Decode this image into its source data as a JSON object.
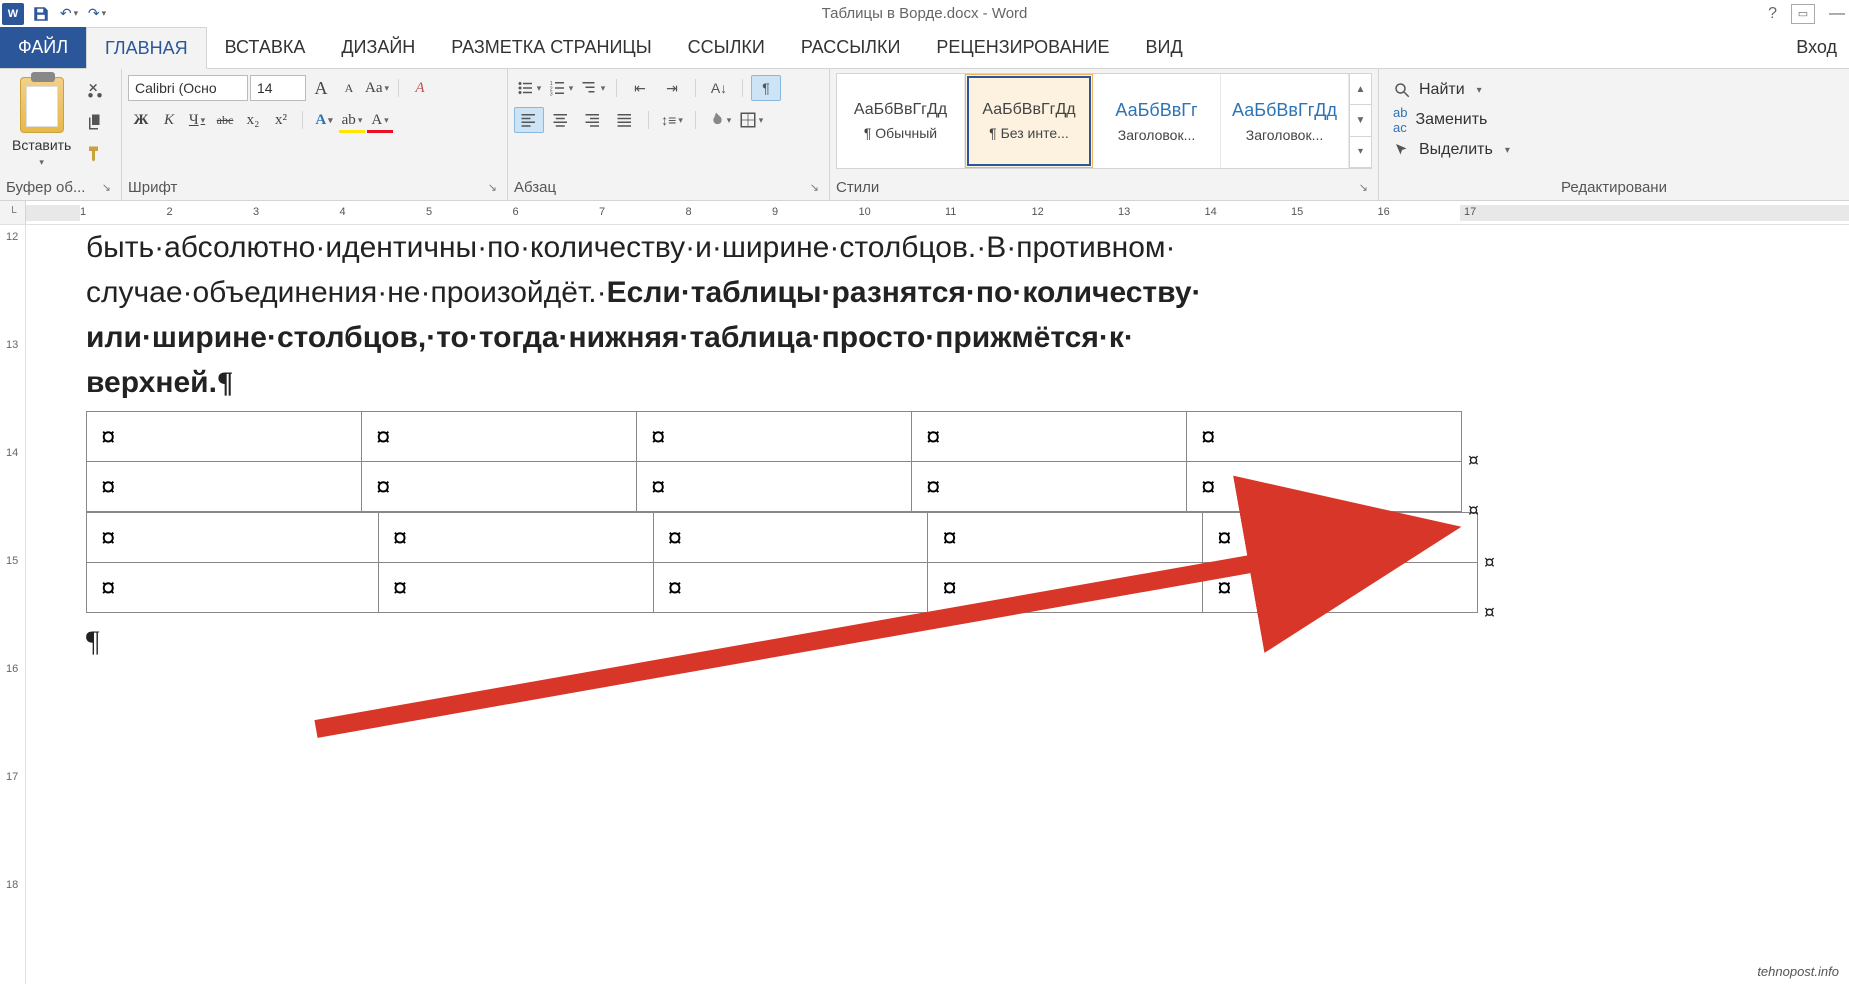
{
  "title": {
    "filename": "Таблицы в Ворде.docx",
    "appname": "Word"
  },
  "qat": {
    "undo": "↶",
    "redo": "↷"
  },
  "window_controls": {
    "help": "?",
    "ribbon_opts": "▭",
    "minimize": "—"
  },
  "tabs": {
    "file": "ФАЙЛ",
    "home": "ГЛАВНАЯ",
    "insert": "ВСТАВКА",
    "design": "ДИЗАЙН",
    "layout": "РАЗМЕТКА СТРАНИЦЫ",
    "references": "ССЫЛКИ",
    "mailings": "РАССЫЛКИ",
    "review": "РЕЦЕНЗИРОВАНИЕ",
    "view": "ВИД",
    "signin": "Вход"
  },
  "clipboard": {
    "paste": "Вставить",
    "group": "Буфер об..."
  },
  "font": {
    "name": "Calibri (Осно",
    "size": "14",
    "group": "Шрифт",
    "bold": "Ж",
    "italic": "К",
    "underline": "Ч",
    "strike": "abc",
    "sub": "x₂",
    "sup": "x²",
    "grow": "A",
    "shrink": "A",
    "case": "Aa",
    "clear": "A"
  },
  "paragraph": {
    "group": "Абзац"
  },
  "styles": {
    "group": "Стили",
    "items": [
      {
        "preview": "АаБбВвГгДд",
        "name": "¶ Обычный"
      },
      {
        "preview": "АаБбВвГгДд",
        "name": "¶ Без инте..."
      },
      {
        "preview": "АаБбВвГг",
        "name": "Заголовок..."
      },
      {
        "preview": "АаБбВвГгДд",
        "name": "Заголовок..."
      }
    ]
  },
  "editing": {
    "group": "Редактировани",
    "find": "Найти",
    "replace": "Заменить",
    "select": "Выделить"
  },
  "ruler": {
    "numbers": [
      1,
      2,
      3,
      4,
      5,
      6,
      7,
      8,
      9,
      10,
      11,
      12,
      13,
      14,
      15,
      16,
      17
    ],
    "corner": "└"
  },
  "vruler": {
    "numbers": [
      12,
      13,
      14,
      15,
      16,
      17,
      18
    ]
  },
  "document": {
    "line1": "быть·абсолютно·идентичны·по·количеству·и·ширине·столбцов.·В·противном·",
    "line2a": "случае·объединения·не·произойдёт.·",
    "line2b": "Если·таблицы·разнятся·по·количеству·",
    "line3": "или·ширине·столбцов,·то·тогда·нижняя·таблица·просто·прижмётся·к·",
    "line4": "верхней.",
    "pilcrow": "¶",
    "cell": "¤"
  },
  "watermark": "tehnopost.info"
}
